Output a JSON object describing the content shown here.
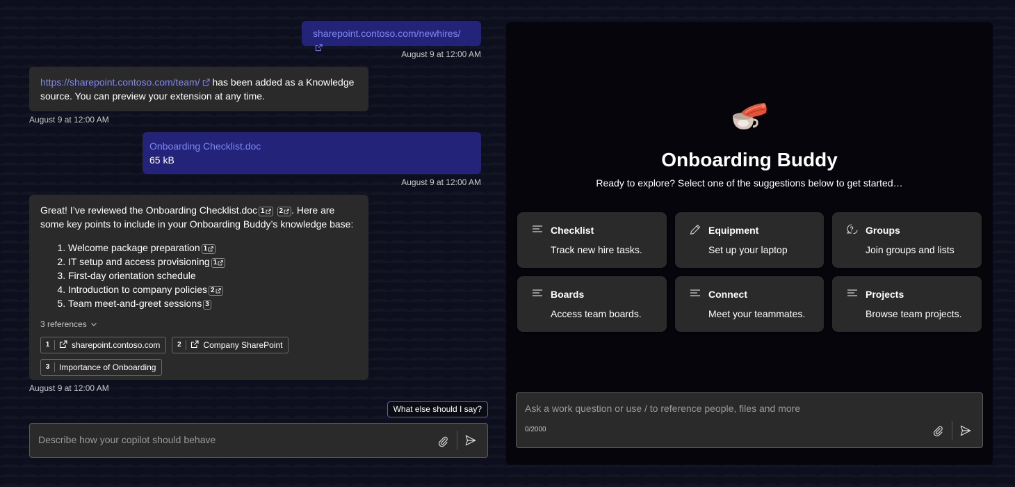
{
  "chat": {
    "msg1": {
      "link": "sharepoint.contoso.com/newhires/",
      "timestamp": "August 9 at 12:00 AM"
    },
    "msg2": {
      "link": "https://sharepoint.contoso.com/team/",
      "text": " has been added as a Knowledge source. You can preview your extension at any time.",
      "timestamp": "August 9 at 12:00 AM"
    },
    "msg3": {
      "file_name": "Onboarding Checklist.doc",
      "file_size": "65 kB",
      "timestamp": "August 9 at 12:00 AM"
    },
    "msg4": {
      "intro_a": "Great! I’ve reviewed the Onboarding Checklist.doc",
      "intro_cite1": "1",
      "intro_cite2": "2",
      "intro_b": ". Here are some key points to include in your Onboarding Buddy’s knowledge base:",
      "points": [
        {
          "text": "Welcome package preparation",
          "cite": "1"
        },
        {
          "text": "IT setup and access provisioning",
          "cite": "1"
        },
        {
          "text": "First-day orientation schedule",
          "cite": ""
        },
        {
          "text": "Introduction to company policies",
          "cite": "2"
        },
        {
          "text": "Team meet-and-greet sessions",
          "cite": "3"
        }
      ],
      "refs_toggle": "3 references",
      "references": [
        {
          "num": "1",
          "label": "sharepoint.contoso.com"
        },
        {
          "num": "2",
          "label": "Company SharePoint"
        },
        {
          "num": "3",
          "label": "Importance of Onboarding"
        }
      ],
      "timestamp": "August 9 at 12:00 AM"
    },
    "suggestion": "What else should I say?",
    "composer_placeholder": "Describe how your copilot should behave"
  },
  "preview": {
    "title": "Onboarding Buddy",
    "subtitle": "Ready to explore? Select one of the suggestions below to get started…",
    "cards": [
      {
        "title": "Checklist",
        "desc": "Track new hire tasks.",
        "icon": "lines-icon"
      },
      {
        "title": "Equipment",
        "desc": "Set up your laptop",
        "icon": "pencil-icon"
      },
      {
        "title": "Groups",
        "desc": "Join groups and lists",
        "icon": "chat-question-icon"
      },
      {
        "title": "Boards",
        "desc": "Access team boards.",
        "icon": "lines-icon"
      },
      {
        "title": "Connect",
        "desc": "Meet your teammates.",
        "icon": "lines-icon"
      },
      {
        "title": "Projects",
        "desc": "Browse team projects.",
        "icon": "lines-icon"
      }
    ],
    "composer_placeholder": "Ask a work question or use / to reference people, files and more",
    "char_count": "0/2000"
  },
  "colors": {
    "background": "#0e0f1e",
    "user_bubble": "#23237a",
    "bot_bubble": "#2a2a2a",
    "link": "#7f86f0",
    "accent_border": "#5b5fc7"
  }
}
